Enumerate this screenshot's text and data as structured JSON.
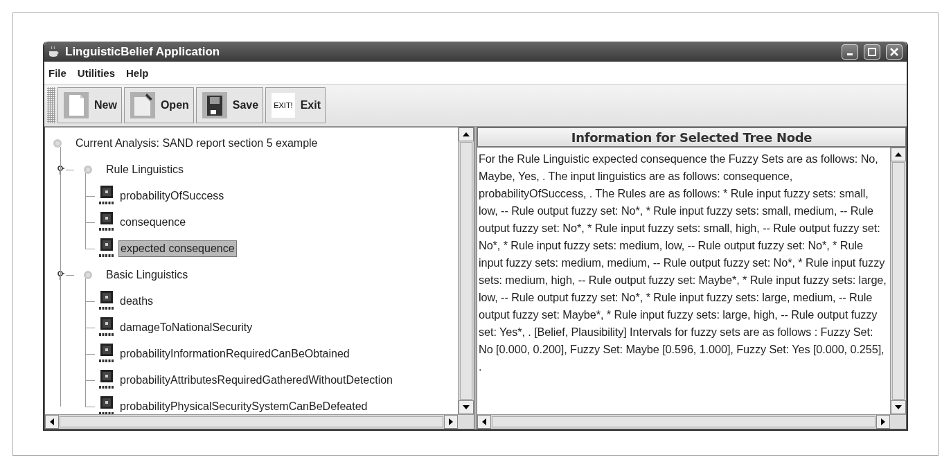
{
  "window": {
    "title": "LinguisticBelief Application"
  },
  "menu": [
    "File",
    "Utilities",
    "Help"
  ],
  "toolbar": [
    {
      "label": "New",
      "kind": "new"
    },
    {
      "label": "Open",
      "kind": "open"
    },
    {
      "label": "Save",
      "kind": "save"
    },
    {
      "label": "Exit",
      "kind": "exit",
      "badge": "EXIT!"
    }
  ],
  "tree": {
    "label": "Current Analysis: SAND report section 5 example",
    "kind": "root",
    "children": [
      {
        "label": "Rule Linguistics",
        "kind": "group",
        "expanded": true,
        "children": [
          {
            "label": "probabilityOfSuccess",
            "kind": "fuzzy",
            "selected": false
          },
          {
            "label": "consequence",
            "kind": "fuzzy",
            "selected": false
          },
          {
            "label": "expected consequence",
            "kind": "fuzzy",
            "selected": true
          }
        ]
      },
      {
        "label": "Basic Linguistics",
        "kind": "group",
        "expanded": true,
        "children": [
          {
            "label": "deaths",
            "kind": "fuzzy",
            "selected": false
          },
          {
            "label": "damageToNationalSecurity",
            "kind": "fuzzy",
            "selected": false
          },
          {
            "label": "probabilityInformationRequiredCanBeObtained",
            "kind": "fuzzy",
            "selected": false
          },
          {
            "label": "probabilityAttributesRequiredGatheredWithoutDetection",
            "kind": "fuzzy",
            "selected": false
          },
          {
            "label": "probabilityPhysicalSecuritySystemCanBeDefeated",
            "kind": "fuzzy",
            "selected": false
          }
        ]
      }
    ]
  },
  "info_panel": {
    "title": "Information for Selected Tree Node",
    "text": "For the Rule Linguistic expected consequence the Fuzzy Sets are as follows: No, Maybe, Yes, .  The input linguistics are as follows: consequence, probabilityOfSuccess, .  The Rules are as follows: * Rule input fuzzy sets: small, low, -- Rule output fuzzy set: No*, * Rule input fuzzy sets: small, medium, -- Rule output fuzzy set: No*, * Rule input fuzzy sets: small, high, -- Rule output fuzzy set: No*, * Rule input fuzzy sets: medium, low, -- Rule output fuzzy set: No*, * Rule input fuzzy sets: medium, medium, -- Rule output fuzzy set: No*, * Rule input fuzzy sets: medium, high, -- Rule output fuzzy set: Maybe*, * Rule input fuzzy sets: large, low, -- Rule output fuzzy set: No*, * Rule input fuzzy sets: large, medium, -- Rule output fuzzy set: Maybe*, * Rule input fuzzy sets: large, high, -- Rule output fuzzy set: Yes*, . [Belief, Plausibility] Intervals for fuzzy sets are as follows : Fuzzy Set: No [0.000, 0.200], Fuzzy Set: Maybe [0.596, 1.000], Fuzzy Set: Yes [0.000, 0.255], ."
  }
}
